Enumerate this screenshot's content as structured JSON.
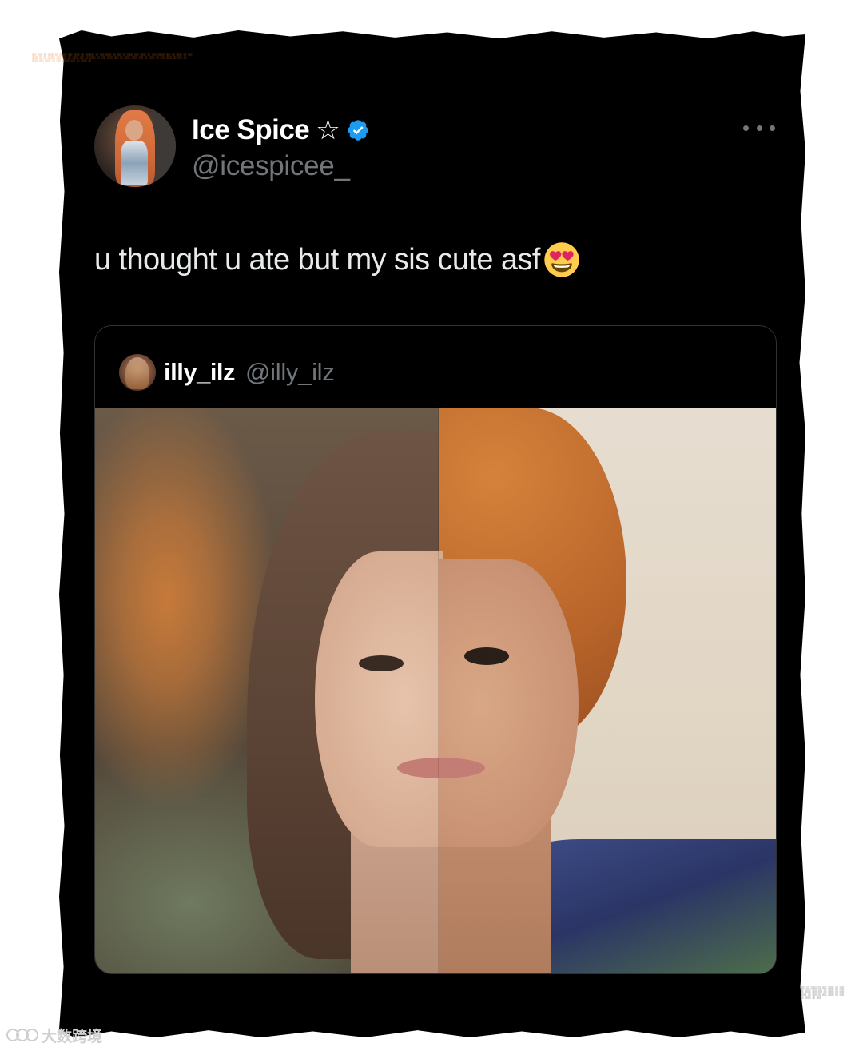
{
  "tweet": {
    "display_name": "Ice Spice",
    "name_badge": "☆",
    "handle": "@icespicee_",
    "text": "u thought u ate but my sis cute asf",
    "text_emoji": "heart-eyes-emoji",
    "more_icon": "more-horizontal-icon"
  },
  "quoted_tweet": {
    "display_name": "illy_ilz",
    "handle": "@illy_ilz",
    "image": "split-face-photo"
  },
  "watermark": {
    "brand": "大数跨境"
  },
  "colors": {
    "background": "#000000",
    "primary_text": "#e7e9ea",
    "secondary_text": "#71767b",
    "verified_blue": "#1d9bf0",
    "border": "#2f3336"
  }
}
